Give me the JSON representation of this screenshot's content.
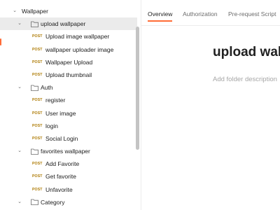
{
  "sidebar": {
    "collection": {
      "name": "Wallpaper",
      "folders": [
        {
          "name": "upload wallpaper",
          "selected": true,
          "requests": [
            {
              "method": "POST",
              "name": "Upload image wallpaper"
            },
            {
              "method": "POST",
              "name": "wallpaper uploader image"
            },
            {
              "method": "POST",
              "name": "Wallpaper Upload"
            },
            {
              "method": "POST",
              "name": "Upload thumbnail"
            }
          ]
        },
        {
          "name": "Auth",
          "requests": [
            {
              "method": "POST",
              "name": "register"
            },
            {
              "method": "POST",
              "name": "User image"
            },
            {
              "method": "POST",
              "name": "login"
            },
            {
              "method": "POST",
              "name": "Social Login"
            }
          ]
        },
        {
          "name": "favorites wallpaper",
          "requests": [
            {
              "method": "POST",
              "name": "Add Favorite"
            },
            {
              "method": "POST",
              "name": "Get favorite"
            },
            {
              "method": "POST",
              "name": "Unfavorite"
            }
          ]
        },
        {
          "name": "Category",
          "requests": []
        }
      ]
    }
  },
  "tabs": [
    {
      "label": "Overview",
      "active": true
    },
    {
      "label": "Authorization"
    },
    {
      "label": "Pre-request Script"
    }
  ],
  "main": {
    "title": "upload wal",
    "description_placeholder": "Add folder description"
  },
  "colors": {
    "accent": "#ff6c37",
    "post_method": "#ad7a03",
    "selected_row": "#ebebeb"
  },
  "icons": {
    "expand": "chevron-down-icon",
    "folder": "folder-icon"
  }
}
